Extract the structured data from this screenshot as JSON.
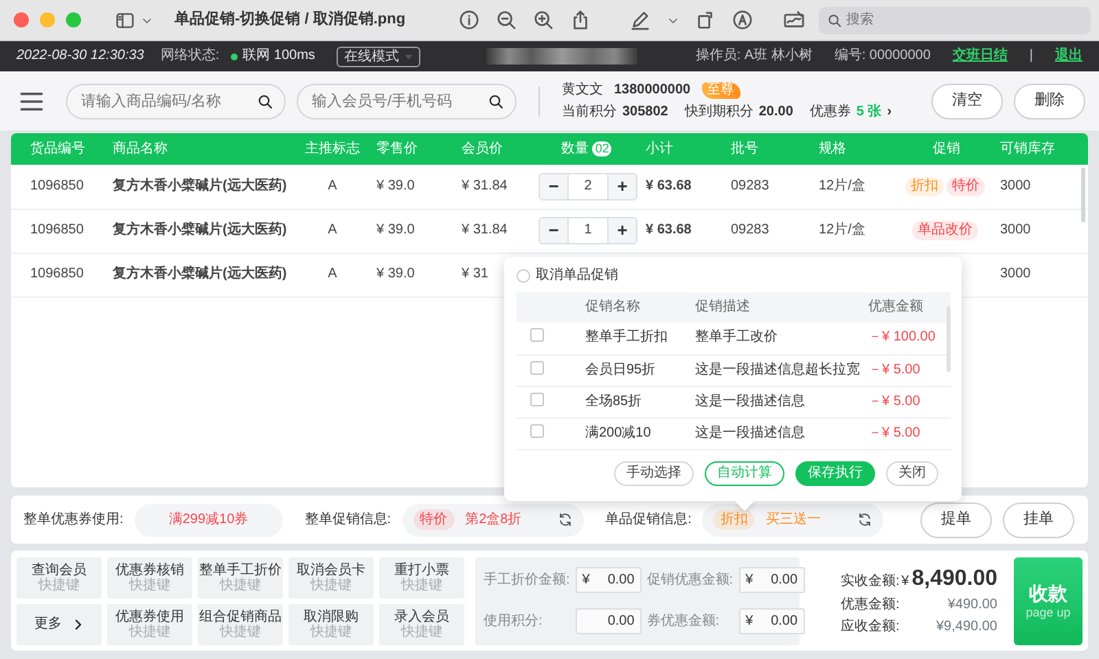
{
  "window": {
    "title": "单品促销-切换促销 / 取消促销.png",
    "search_placeholder": "搜索"
  },
  "status_bar": {
    "time": "2022-08-30 12:30:33",
    "network_label": "网络状态:",
    "network_online": true,
    "network": "联网 100ms",
    "mode": "在线模式",
    "operator": "操作员: A班 林小树",
    "number": "编号: 00000000",
    "shift_close": "交班日结",
    "separator": "|",
    "logout": "退出"
  },
  "toolbar": {
    "product_search": {
      "placeholder": "请输入商品编码/名称"
    },
    "member_search": {
      "placeholder": "输入会员号/手机号码"
    },
    "member": {
      "name": "黄文文",
      "phone": "1380000000",
      "tier": "至尊",
      "points_label": "当前积分",
      "points": "305802",
      "expiring_label": "快到期积分",
      "expiring": "20.00",
      "coupons_label": "优惠券",
      "coupons": "5 张",
      "coupons_arrow": "›"
    },
    "buttons": [
      "清空",
      "删除"
    ]
  },
  "table": {
    "stepper_minus": "−",
    "stepper_plus": "+",
    "columns": [
      "货品编号",
      "商品名称",
      "主推标志",
      "零售价",
      "会员价",
      "数量",
      "小计",
      "批号",
      "规格",
      "促销",
      "可销库存"
    ],
    "quantity_badge": "02",
    "rows": [
      {
        "code": "1096850",
        "name": "复方木香小檗碱片(远大医药)",
        "flag": "A",
        "retail": "¥ 39.0",
        "member": "¥ 31.84",
        "qty": "2",
        "subtotal": "¥ 63.68",
        "batch": "09283",
        "spec": "12片/盒",
        "promos": [
          {
            "label": "折扣",
            "color": "#ff8c1a"
          },
          {
            "label": "特价",
            "color": "#f5454b"
          }
        ],
        "stock": "3000"
      },
      {
        "code": "1096850",
        "name": "复方木香小檗碱片(远大医药)",
        "flag": "A",
        "retail": "¥ 39.0",
        "member": "¥ 31.84",
        "qty": "1",
        "subtotal": "¥ 63.68",
        "batch": "09283",
        "spec": "12片/盒",
        "promos": [
          {
            "label": "单品改价",
            "color": "#f5454b"
          }
        ],
        "stock": "3000"
      },
      {
        "code": "1096850",
        "name": "复方木香小檗碱片(远大医药)",
        "flag": "A",
        "retail": "¥ 39.0",
        "member": "¥ 31",
        "stock": "3000"
      }
    ]
  },
  "promo_popup": {
    "cancel_option": {
      "label": "取消单品促销",
      "selected": false
    },
    "columns": [
      "促销名称",
      "促销描述",
      "优惠金额"
    ],
    "rows": [
      {
        "checked": false,
        "name": "整单手工折扣",
        "description": "整单手工改价",
        "amount": "－¥ 100.00"
      },
      {
        "checked": false,
        "name": "会员日95折",
        "description": "这是一段描述信息超长拉宽",
        "amount": "－¥ 5.00"
      },
      {
        "checked": false,
        "name": "全场85折",
        "description": "这是一段描述信息",
        "amount": "－¥ 5.00"
      },
      {
        "checked": false,
        "name": "满200减10",
        "description": "这是一段描述信息",
        "amount": "－¥ 5.00"
      }
    ],
    "buttons": [
      {
        "label": "手动选择",
        "kind": "outline"
      },
      {
        "label": "自动计算",
        "kind": "accent"
      },
      {
        "label": "保存执行",
        "kind": "primary"
      },
      {
        "label": "关闭",
        "kind": "outline"
      }
    ]
  },
  "promo_bar": {
    "coupon": {
      "label": "整单优惠券使用:",
      "value": "满299减10券"
    },
    "order_promo": {
      "label": "整单促销信息:",
      "tag": "特价",
      "detail": "第2盒8折",
      "color": "#f5454b"
    },
    "item_promo": {
      "label": "单品促销信息:",
      "tag": "折扣",
      "detail": "买三送一",
      "color": "#ff8c1a"
    },
    "buttons": [
      "提单",
      "挂单"
    ]
  },
  "function_keys": [
    {
      "kind": "key",
      "label": "查询会员",
      "hint": "快捷键"
    },
    {
      "kind": "key",
      "label": "优惠券核销",
      "hint": "快捷键"
    },
    {
      "kind": "key",
      "label": "整单手工折价",
      "hint": "快捷键"
    },
    {
      "kind": "key",
      "label": "取消会员卡",
      "hint": "快捷键"
    },
    {
      "kind": "key",
      "label": "重打小票",
      "hint": "快捷键"
    },
    {
      "kind": "more",
      "label": "更多"
    },
    {
      "kind": "key",
      "label": "优惠券使用",
      "hint": "快捷键"
    },
    {
      "kind": "key",
      "label": "组合促销商品",
      "hint": "快捷键"
    },
    {
      "kind": "key",
      "label": "取消限购",
      "hint": "快捷键"
    },
    {
      "kind": "key",
      "label": "录入会员",
      "hint": "快捷键"
    }
  ],
  "amounts": [
    {
      "label": "手工折价金额:",
      "currency": "¥",
      "value": "0.00"
    },
    {
      "label": "促销优惠金额:",
      "currency": "¥",
      "value": "0.00"
    },
    {
      "label": "使用积分:",
      "value": "0.00"
    },
    {
      "label": "券优惠金额:",
      "currency": "¥",
      "value": "0.00"
    }
  ],
  "totals": {
    "received_label": "实收金额:",
    "received_currency": "¥",
    "received": "8,490.00",
    "discount_label": "优惠金额:",
    "discount": "¥490.00",
    "due_label": "应收金额:",
    "due": "¥9,490.00"
  },
  "pay_button": {
    "label": "收款",
    "hint": "page up"
  }
}
